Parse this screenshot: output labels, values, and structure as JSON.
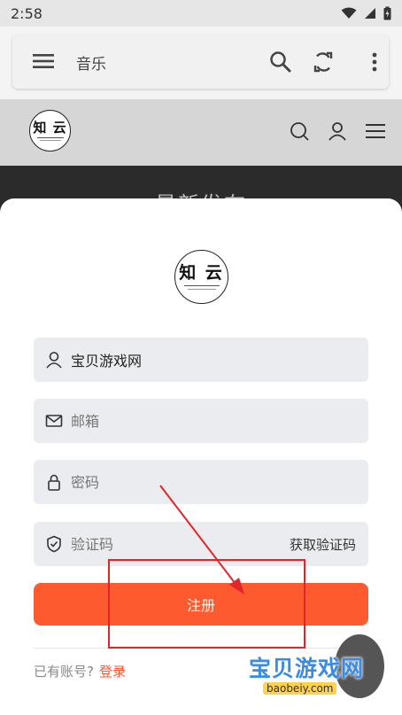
{
  "status_bar": {
    "time": "2:58"
  },
  "browser": {
    "title": "音乐"
  },
  "site": {
    "logo_text": "知 云"
  },
  "band": {
    "heading": "最新发布"
  },
  "form": {
    "username_value": "宝贝游戏网",
    "email_placeholder": "邮箱",
    "password_placeholder": "密码",
    "code_placeholder": "验证码",
    "get_code_label": "获取验证码",
    "register_label": "注册",
    "have_account_text": "已有账号?",
    "login_link": "登录"
  },
  "watermark": {
    "title": "宝贝游戏网",
    "domain": "baobeiy.com"
  },
  "colors": {
    "accent": "#fd5a2f",
    "annotation": "#e0262b"
  }
}
